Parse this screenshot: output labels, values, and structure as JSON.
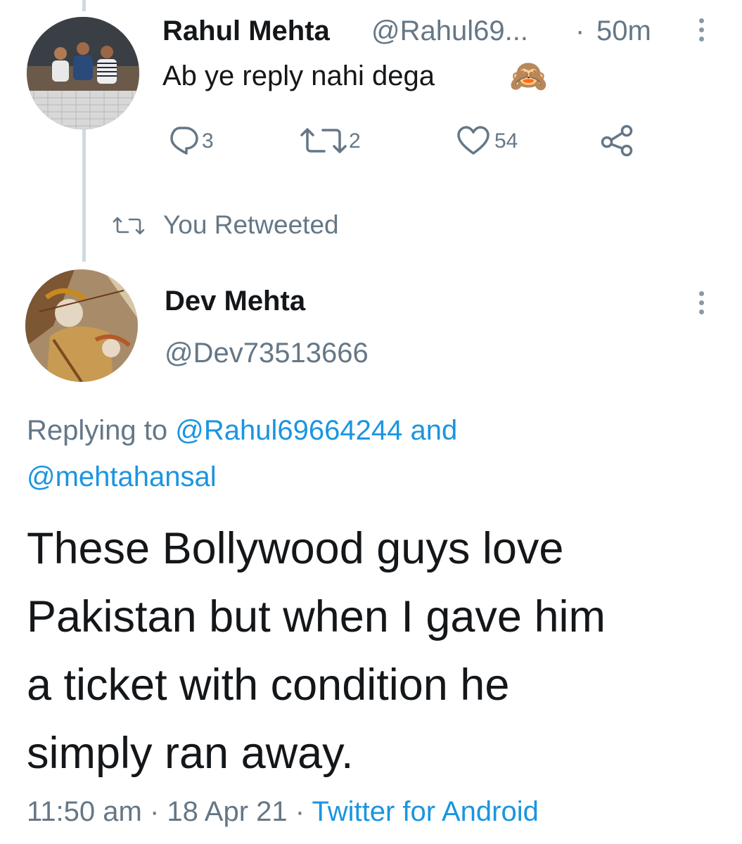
{
  "parent_tweet": {
    "author_name": "Rahul Mehta",
    "author_handle": "@Rahul69...",
    "separator": "·",
    "time": "50m",
    "text": "Ab ye reply nahi dega",
    "emoji": "🙈",
    "actions": {
      "reply_count": "3",
      "retweet_count": "2",
      "like_count": "54"
    }
  },
  "retweet_context": {
    "label": "You Retweeted"
  },
  "main_tweet": {
    "author_name": "Dev Mehta",
    "author_handle": "@Dev73513666",
    "replying_prefix": "Replying to",
    "reply_mention_1": "@Rahul69664244",
    "reply_and": "and",
    "reply_mention_2": "@mehtahansal",
    "text_lines": [
      "These Bollywood guys love",
      "Pakistan but when I gave him",
      "a ticket with condition he",
      "simply ran away."
    ],
    "time": "11:50 am",
    "dot1": "·",
    "date": "18 Apr 21",
    "dot2": "·",
    "source": "Twitter for Android"
  },
  "colors": {
    "link": "#1b95e0",
    "muted": "#657786",
    "text": "#14171a",
    "thread_line": "#cfd9de"
  },
  "icons": [
    "reply-icon",
    "retweet-icon",
    "like-icon",
    "share-icon",
    "more-icon"
  ]
}
